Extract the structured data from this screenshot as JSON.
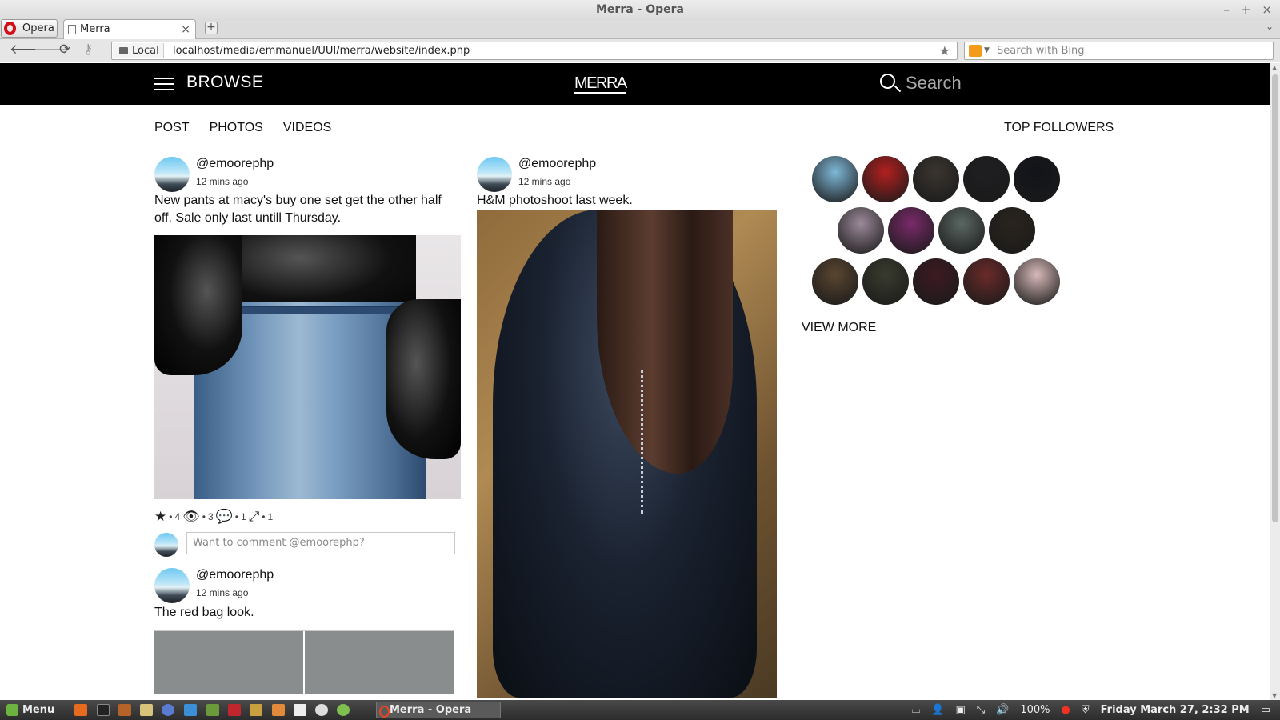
{
  "window": {
    "title": "Merra - Opera",
    "controls": [
      "–",
      "+",
      "×"
    ]
  },
  "browser": {
    "opera_button": "Opera",
    "tab_title": "Merra",
    "security_label": "Local",
    "url": "localhost/media/emmanuel/UUI/merra/website/index.php",
    "search_placeholder": "Search with Bing"
  },
  "site": {
    "browse_label": "BROWSE",
    "logo": "MERRA",
    "search_label": "Search",
    "tabs": [
      "POST",
      "PHOTOS",
      "VIDEOS"
    ],
    "top_followers_title": "TOP FOLLOWERS",
    "view_more": "VIEW MORE"
  },
  "posts": [
    {
      "user": "@emoorephp",
      "time": "12 mins ago",
      "text": "New pants at macy's buy one set get the other half off. Sale only last untill Thursday.",
      "stats": {
        "stars": "4",
        "views": "3",
        "comments": "1",
        "shares": "1"
      },
      "comment_placeholder": "Want to comment @emoorephp?"
    },
    {
      "user": "@emoorephp",
      "time": "12 mins ago",
      "text": "H&M photoshoot last week."
    },
    {
      "user": "@emoorephp",
      "time": "12 mins ago",
      "text": "The red bag look."
    }
  ],
  "follower_colors": [
    [
      "#7fb8d8",
      "#b3201f",
      "#3a3530",
      "#1f1f22",
      "#121419"
    ],
    [
      "#9c8a9a",
      "#7a2a6a",
      "#5b6762",
      "#2a241d"
    ],
    [
      "#5a4630",
      "#3a3b2e",
      "#3d1a22",
      "#6b2a2a",
      "#d8b9b9"
    ]
  ],
  "taskbar": {
    "menu_label": "Menu",
    "active_task": "Merra - Opera",
    "battery": "100%",
    "clock": "Friday March 27,  2:32 PM"
  }
}
